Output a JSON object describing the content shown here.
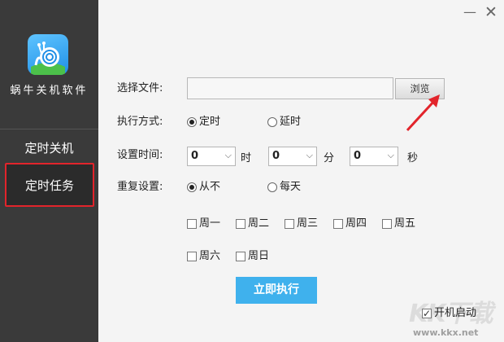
{
  "sidebar": {
    "brand": "蜗牛关机软件",
    "items": [
      {
        "label": "定时关机"
      },
      {
        "label": "定时任务"
      }
    ]
  },
  "window": {
    "minimize": "—",
    "close": "✕"
  },
  "form": {
    "file_label": "选择文件:",
    "file_value": "",
    "browse_label": "浏览",
    "mode_label": "执行方式:",
    "mode_options": [
      "定时",
      "延时"
    ],
    "mode_selected": "定时",
    "time_label": "设置时间:",
    "hour": "0",
    "hour_unit": "时",
    "minute": "0",
    "minute_unit": "分",
    "second": "0",
    "second_unit": "秒",
    "repeat_label": "重复设置:",
    "repeat_options": [
      "从不",
      "每天"
    ],
    "repeat_selected": "从不",
    "weekdays": [
      "周一",
      "周二",
      "周三",
      "周四",
      "周五",
      "周六",
      "周日"
    ],
    "run_label": "立即执行",
    "autostart_label": "开机启动",
    "autostart_checked": true
  },
  "watermark": {
    "url": "www.kkx.net"
  },
  "colors": {
    "sidebar_bg": "#3a3a3a",
    "highlight_border": "#e2242b",
    "run_button": "#3fb1ed",
    "annotation_arrow": "#e2242b"
  }
}
